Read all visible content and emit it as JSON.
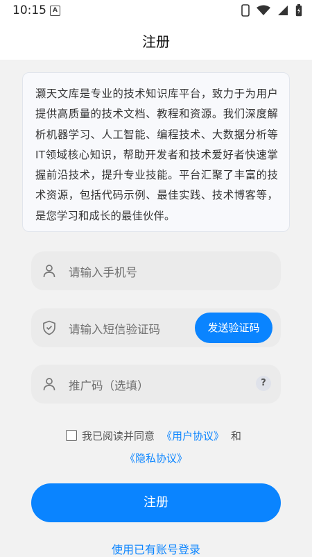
{
  "status_bar": {
    "time": "10:15",
    "notification_letter": "A"
  },
  "header": {
    "title": "注册"
  },
  "intro": {
    "text": "灏天文库是专业的技术知识库平台，致力于为用户提供高质量的技术文档、教程和资源。我们深度解析机器学习、人工智能、编程技术、大数据分析等IT领域核心知识，帮助开发者和技术爱好者快速掌握前沿技术，提升专业技能。平台汇聚了丰富的技术资源，包括代码示例、最佳实践、技术博客等，是您学习和成长的最佳伙伴。"
  },
  "form": {
    "phone": {
      "placeholder": "请输入手机号",
      "icon": "person-icon"
    },
    "sms": {
      "placeholder": "请输入短信验证码",
      "icon": "shield-icon",
      "send_label": "发送验证码"
    },
    "referral": {
      "placeholder": "推广码（选填）",
      "icon": "person-icon",
      "help": "?"
    }
  },
  "agreement": {
    "prefix": "我已阅读并同意",
    "user_agreement": "《用户协议》",
    "and": "和",
    "privacy_policy": "《隐私协议》"
  },
  "actions": {
    "register": "注册",
    "login_link": "使用已有账号登录"
  },
  "colors": {
    "accent": "#0a84ff",
    "background": "#f2f2f2",
    "field": "#ebebeb"
  }
}
